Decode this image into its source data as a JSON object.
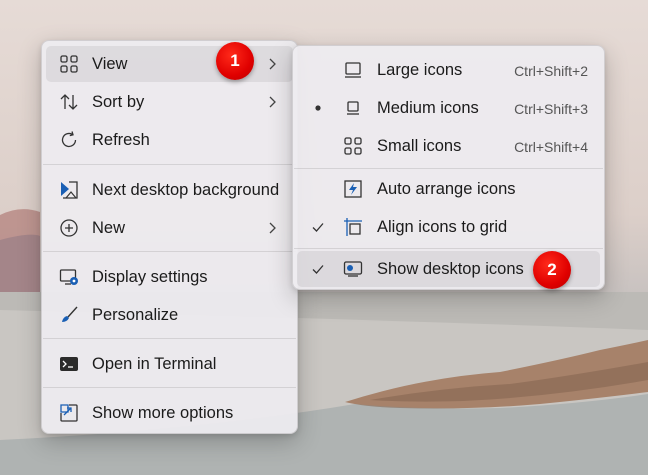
{
  "context_menu": {
    "items": [
      {
        "label": "View",
        "icon": "grid-icon",
        "has_submenu": true
      },
      {
        "label": "Sort by",
        "icon": "sort-icon",
        "has_submenu": true
      },
      {
        "label": "Refresh",
        "icon": "refresh-icon",
        "has_submenu": false
      },
      {
        "label": "Next desktop background",
        "icon": "next-background-icon",
        "has_submenu": false
      },
      {
        "label": "New",
        "icon": "plus-circle-icon",
        "has_submenu": true
      },
      {
        "label": "Display settings",
        "icon": "display-settings-icon",
        "has_submenu": false
      },
      {
        "label": "Personalize",
        "icon": "brush-icon",
        "has_submenu": false
      },
      {
        "label": "Open in Terminal",
        "icon": "terminal-icon",
        "has_submenu": false
      },
      {
        "label": "Show more options",
        "icon": "more-options-icon",
        "has_submenu": false
      }
    ]
  },
  "view_submenu": {
    "items": [
      {
        "label": "Large icons",
        "shortcut": "Ctrl+Shift+2",
        "mark": "",
        "icon": "large-icons-icon"
      },
      {
        "label": "Medium icons",
        "shortcut": "Ctrl+Shift+3",
        "mark": "bullet",
        "icon": "medium-icons-icon"
      },
      {
        "label": "Small icons",
        "shortcut": "Ctrl+Shift+4",
        "mark": "",
        "icon": "small-icons-icon"
      },
      {
        "label": "Auto arrange icons",
        "shortcut": "",
        "mark": "",
        "icon": "auto-arrange-icon"
      },
      {
        "label": "Align icons to grid",
        "shortcut": "",
        "mark": "check",
        "icon": "align-grid-icon"
      },
      {
        "label": "Show desktop icons",
        "shortcut": "",
        "mark": "check",
        "icon": "show-desktop-icon"
      }
    ]
  },
  "annotations": {
    "step1": "1",
    "step2": "2"
  },
  "colors": {
    "badge": "#e00000",
    "accent_icon": "#1a5fb4"
  }
}
